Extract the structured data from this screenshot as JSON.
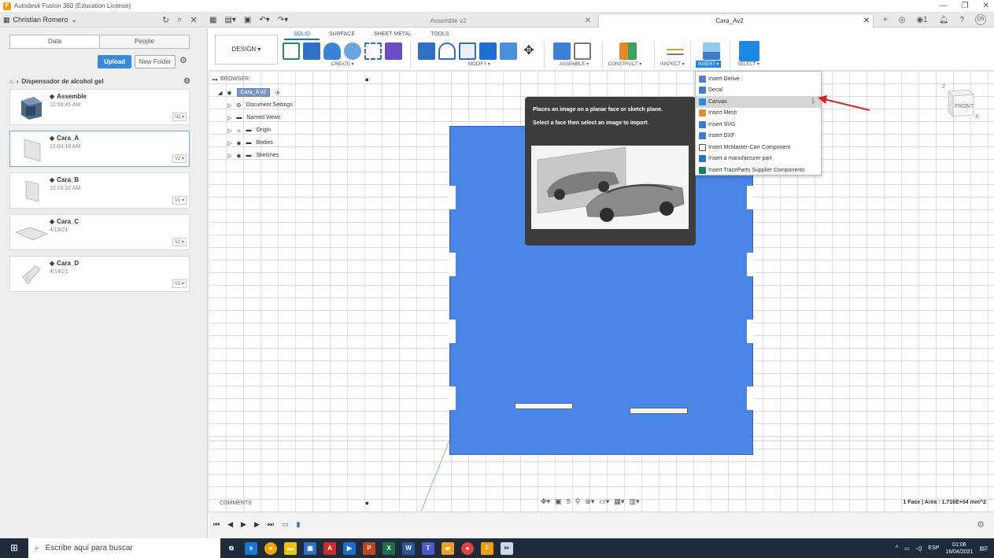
{
  "window": {
    "title": "Autodesk Fusion 360 (Education License)",
    "controls": [
      "—",
      "❐",
      "✕"
    ]
  },
  "tabbar": {
    "user": "Christian Romero",
    "inactive_tab": "Assemble v2",
    "active_tab": "Cara_Av2",
    "notification_count": "1",
    "avatar_initials": "CR"
  },
  "data_panel": {
    "tab_data": "Data",
    "tab_people": "People",
    "upload": "Upload",
    "new_folder": "New Folder",
    "path": "Dispensador de alcohol gel",
    "files": [
      {
        "name": "Assemble",
        "date": "12:59:45 AM",
        "version": "V2 ▾"
      },
      {
        "name": "Cara_A",
        "date": "12:04:18 AM",
        "version": "V2 ▾"
      },
      {
        "name": "Cara_B",
        "date": "12:16:22 AM",
        "version": "V1 ▾"
      },
      {
        "name": "Cara_C",
        "date": "4/13/21",
        "version": "V2 ▾"
      },
      {
        "name": "Cara_D",
        "date": "4/14/21",
        "version": "V2 ▾"
      }
    ]
  },
  "toolbar": {
    "workspace": "DESIGN ▾",
    "tabs": [
      "SOLID",
      "SURFACE",
      "SHEET METAL",
      "TOOLS"
    ],
    "groups": {
      "create": "CREATE ▾",
      "modify": "MODIFY ▾",
      "assemble": "ASSEMBLE ▾",
      "construct": "CONSTRUCT ▾",
      "inspect": "INSPECT ▾",
      "insert": "INSERT ▾",
      "select": "SELECT ▾"
    }
  },
  "browser": {
    "label": "BROWSER",
    "root": "Cara_A v2",
    "nodes": [
      "Document Settings",
      "Named Views",
      "Origin",
      "Bodies",
      "Sketches"
    ]
  },
  "tooltip": {
    "line1": "Places an image on a planar face or sketch plane.",
    "line2": "Select a face then select an image to import."
  },
  "insert_menu": {
    "items": [
      {
        "label": "Insert Derive",
        "color": "#5b7fb8"
      },
      {
        "label": "Decal",
        "color": "#3f7fcf"
      },
      {
        "label": "Canvas",
        "color": "#2f8ed8"
      },
      {
        "label": "Insert Mesh",
        "color": "#e0902a"
      },
      {
        "label": "Insert SVG",
        "color": "#3b7bd1"
      },
      {
        "label": "Insert DXF",
        "color": "#3b7bd1"
      },
      {
        "label": "Insert McMaster-Carr Component",
        "color": "#4a4a4a"
      },
      {
        "label": "Insert a manufacturer part",
        "color": "#2277cc"
      },
      {
        "label": "Insert TraceParts Supplier Components",
        "color": "#1b7f6e"
      }
    ],
    "highlighted_index": 2
  },
  "viewcube": {
    "face": "FRONT",
    "axis_z": "Z",
    "axis_x": "X"
  },
  "bottom": {
    "comments": "COMMENTS",
    "status": "1 Face | Area : 1.716E+04 mm^2"
  },
  "taskbar": {
    "search_placeholder": "Escribe aquí para buscar",
    "lang": "ESP",
    "time": "01:06",
    "date": "16/04/2021",
    "notif": "2"
  },
  "colors": {
    "accent": "#1e88e5",
    "plate": "#4a86e8",
    "arrow": "#e02020"
  }
}
